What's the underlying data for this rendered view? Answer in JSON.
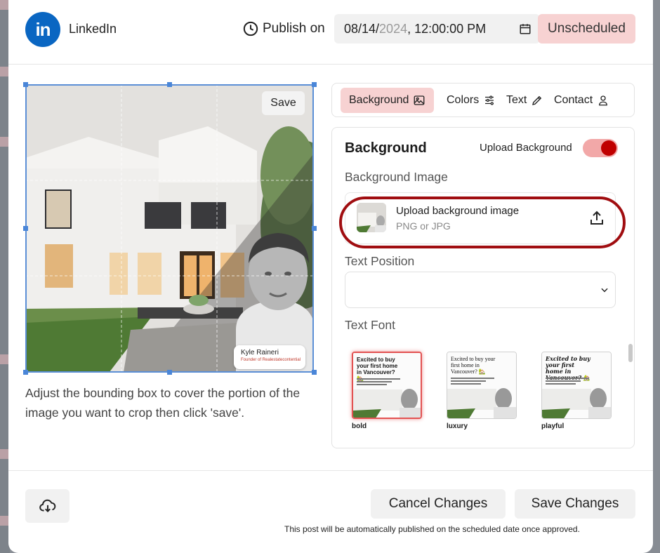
{
  "header": {
    "platform_name": "LinkedIn",
    "logo_text": "in",
    "publish_label": "Publish on",
    "date_value_prefix": "08/14/",
    "date_value_year": "2024",
    "date_value_time": ", 12:00:00 PM",
    "status": "Unscheduled"
  },
  "editor": {
    "save_label": "Save",
    "agent_name": "Kyle Raineri",
    "agent_role": "Founder of Realestatecontential",
    "help_text": "Adjust the bounding box to cover the portion of the image you want to crop then click 'save'."
  },
  "tabs": [
    {
      "label": "Background",
      "icon": "image-icon",
      "active": true
    },
    {
      "label": "Colors",
      "icon": "sliders-icon",
      "active": false
    },
    {
      "label": "Text",
      "icon": "pencil-icon",
      "active": false
    },
    {
      "label": "Contact",
      "icon": "user-icon",
      "active": false
    }
  ],
  "panel": {
    "title": "Background",
    "upload_toggle_label": "Upload Background",
    "upload_toggle_on": true,
    "background_image_label": "Background Image",
    "upload_title": "Upload background image",
    "upload_sub": "PNG or JPG",
    "text_position_label": "Text Position",
    "text_position_value": "",
    "text_font_label": "Text Font",
    "fonts": [
      {
        "name": "bold",
        "headline": "Excited to buy your first home in Vancouver? 🏡",
        "selected": true
      },
      {
        "name": "luxury",
        "headline": "Excited to buy your first home in Vancouver? 🏡",
        "selected": false
      },
      {
        "name": "playful",
        "headline": "Excited to buy your first home in Vancouver? 🏡",
        "selected": false
      }
    ]
  },
  "footer": {
    "cancel_label": "Cancel Changes",
    "save_label": "Save Changes",
    "note": "This post will be automatically published on the scheduled date once approved."
  },
  "colors": {
    "accent_pink": "#f7d2d2",
    "toggle_red": "#c00000",
    "highlight_ring": "#a00d10",
    "linkedin_blue": "#0a66c2"
  }
}
